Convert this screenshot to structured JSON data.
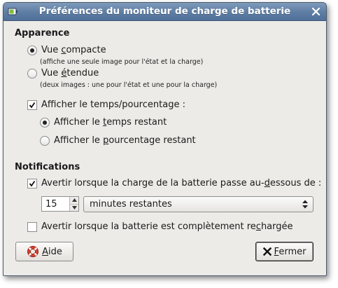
{
  "window": {
    "title": "Préférences du moniteur de charge de batterie"
  },
  "apparence": {
    "heading": "Apparence",
    "compact_label_pre": "Vue ",
    "compact_label_mn": "c",
    "compact_label_post": "ompacte",
    "compact_desc": "(affiche une seule image pour l'état et la charge)",
    "compact_selected": true,
    "extended_label_pre": "Vue ",
    "extended_label_mn": "é",
    "extended_label_post": "tendue",
    "extended_desc": "(deux images : une pour l'état et une pour la charge)",
    "extended_selected": false,
    "show_time_pre": "Af",
    "show_time_mn": "f",
    "show_time_post": "icher le temps/pourcentage :",
    "show_time_checked": true,
    "time_remaining_pre": "Afficher le ",
    "time_remaining_mn": "t",
    "time_remaining_post": "emps restant",
    "time_remaining_selected": true,
    "percent_remaining_pre": "Afficher le ",
    "percent_remaining_mn": "p",
    "percent_remaining_post": "ourcentage restant",
    "percent_remaining_selected": false
  },
  "notifications": {
    "heading": "Notifications",
    "warn_low_pre": "Avertir lorsque la charge de la batterie passe au-",
    "warn_low_mn": "d",
    "warn_low_post": "essous de :",
    "warn_low_checked": true,
    "threshold_value": "15",
    "threshold_unit": "minutes restantes",
    "warn_full_pre": "Avertir lorsque la batterie est complètement re",
    "warn_full_mn": "c",
    "warn_full_post": "hargée",
    "warn_full_checked": false
  },
  "buttons": {
    "help_mn": "A",
    "help_post": "ide",
    "close_mn": "F",
    "close_post": "ermer"
  },
  "icons": {
    "window_menu": "battery-icon",
    "window_close": "close-icon",
    "help": "help-lifebuoy-icon",
    "close": "close-x-icon"
  },
  "colors": {
    "titlebar": "#5e7da3",
    "dialog_bg": "#ecebe8"
  }
}
